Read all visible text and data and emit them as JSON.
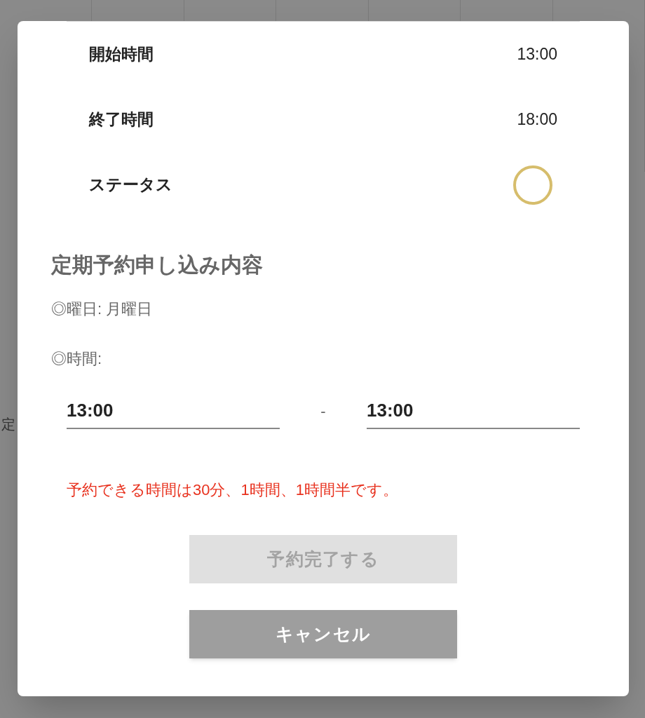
{
  "background": {
    "text_fragment": "定"
  },
  "details": [
    {
      "label": "開始時間",
      "value": "13:00"
    },
    {
      "label": "終了時間",
      "value": "18:00"
    }
  ],
  "status": {
    "label": "ステータス",
    "kind": "circle"
  },
  "recurring": {
    "title": "定期予約申し込み内容",
    "weekday": "◎曜日: 月曜日",
    "time_label": "◎時間:",
    "start": {
      "value": "13:00"
    },
    "separator": "-",
    "end": {
      "value": "13:00"
    },
    "error": "予約できる時間は30分、1時間、1時間半です。"
  },
  "buttons": [
    {
      "label": "予約完了する",
      "kind": "primary",
      "disabled": true
    },
    {
      "label": "キャンセル",
      "kind": "secondary",
      "disabled": false
    }
  ]
}
